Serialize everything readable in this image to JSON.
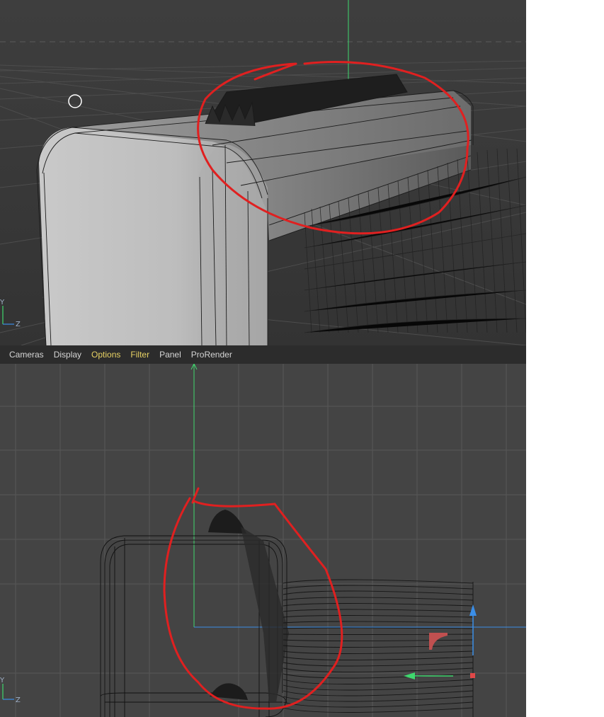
{
  "menubar": {
    "items": [
      {
        "label": "Cameras",
        "highlight": false
      },
      {
        "label": "Display",
        "highlight": false
      },
      {
        "label": "Options",
        "highlight": true
      },
      {
        "label": "Filter",
        "highlight": true
      },
      {
        "label": "Panel",
        "highlight": false
      },
      {
        "label": "ProRender",
        "highlight": false
      }
    ]
  },
  "top_viewport": {
    "axis_y_label": "Y",
    "axis_z_label": "Z",
    "annotation_color": "#e02020"
  },
  "bottom_viewport": {
    "axis_y_label": "Y",
    "axis_z_label": "Z",
    "annotation_color": "#e02020"
  },
  "colors": {
    "menu_text": "#d6d6d6",
    "menu_highlight": "#e8d264",
    "viewport_bg_top": "#3b3b3b",
    "viewport_bg_bottom": "#444444",
    "menubar_bg": "#2c2c2c",
    "y_axis_green": "#3fd86e",
    "x_axis_blue": "#3a8ee8",
    "scribble_red": "#e02020"
  }
}
